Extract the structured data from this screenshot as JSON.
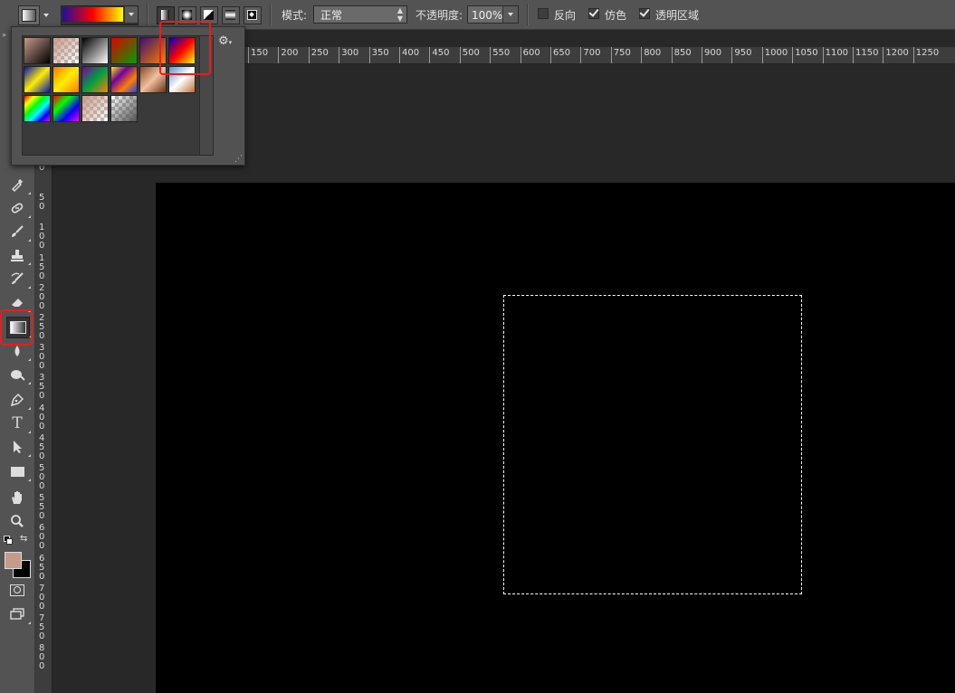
{
  "options_bar": {
    "mode_label": "模式:",
    "mode_value": "正常",
    "opacity_label": "不透明度:",
    "opacity_value": "100%",
    "reverse_label": "反向",
    "reverse_checked": false,
    "dither_label": "仿色",
    "dither_checked": true,
    "transparency_label": "透明区域",
    "transparency_checked": true,
    "gradient_colors": [
      "#1d0f9e",
      "#ff0000",
      "#ffff00"
    ],
    "gradient_types": [
      "linear",
      "radial",
      "angle",
      "reflected",
      "diamond"
    ],
    "selected_gradient_type": "linear"
  },
  "gradient_picker": {
    "gear_icon": "gear-icon",
    "swatches": [
      {
        "name": "foreground-to-background",
        "colors": [
          "#c49a8a",
          "#000000"
        ]
      },
      {
        "name": "foreground-to-transparent",
        "colors": [
          "#c49a8a",
          "transparent"
        ]
      },
      {
        "name": "black-white",
        "colors": [
          "#000000",
          "#ffffff"
        ]
      },
      {
        "name": "red-green",
        "colors": [
          "#e00000",
          "#00a000"
        ]
      },
      {
        "name": "violet-orange",
        "colors": [
          "#3a1070",
          "#ff8000"
        ]
      },
      {
        "name": "blue-red-yellow",
        "colors": [
          "#0000c0",
          "#ff0000",
          "#ffff00"
        ]
      },
      {
        "name": "blue-yellow-blue",
        "colors": [
          "#0010c0",
          "#ffee00",
          "#0010c0"
        ]
      },
      {
        "name": "orange-yellow-orange",
        "colors": [
          "#ff7a00",
          "#ffee00",
          "#ff7a00"
        ]
      },
      {
        "name": "violet-green-orange",
        "colors": [
          "#7a00a0",
          "#00a040",
          "#ff8000"
        ]
      },
      {
        "name": "yellow-violet-orange-blue",
        "colors": [
          "#ffee00",
          "#7000a0",
          "#ff8000",
          "#2040ff"
        ]
      },
      {
        "name": "copper",
        "colors": [
          "#8a4a20",
          "#f0c0a0",
          "#6a3010"
        ]
      },
      {
        "name": "chrome",
        "colors": [
          "#5a90d0",
          "#ffffff",
          "#c07030"
        ]
      },
      {
        "name": "spectrum",
        "colors": [
          "#ff0000",
          "#ffff00",
          "#00ff00",
          "#00ffff",
          "#0000ff",
          "#ff00ff"
        ]
      },
      {
        "name": "transparent-rainbow",
        "colors": [
          "#ff0000",
          "#00ff00",
          "#0000ff",
          "#ff00ff"
        ]
      },
      {
        "name": "transparent-stripes",
        "colors": [
          "#c49a8a",
          "transparent"
        ]
      },
      {
        "name": "neutral-density",
        "colors": [
          "transparent",
          "#555555"
        ]
      }
    ]
  },
  "rulers": {
    "horizontal": [
      "150",
      "200",
      "250",
      "300",
      "350",
      "400",
      "450",
      "500",
      "550",
      "600",
      "650",
      "700",
      "750",
      "800",
      "850",
      "900",
      "950",
      "1000",
      "1050",
      "1100",
      "1150",
      "1200",
      "1250"
    ],
    "vertical": [
      "0",
      "5\n0",
      "1\n0\n0",
      "1\n5\n0",
      "2\n0\n0",
      "2\n5\n0",
      "3\n0\n0",
      "3\n5\n0",
      "4\n0\n0",
      "4\n5\n0",
      "5\n0\n0",
      "5\n5\n0",
      "6\n0\n0",
      "6\n5\n0",
      "7\n0\n0",
      "7\n5\n0",
      "8\n0\n0"
    ]
  },
  "tools": [
    "eyedropper-icon",
    "healing-brush-icon",
    "brush-icon",
    "clone-stamp-icon",
    "history-brush-icon",
    "eraser-icon",
    "gradient-icon",
    "blur-icon",
    "dodge-icon",
    "pen-icon",
    "type-icon",
    "path-select-icon",
    "rectangle-icon",
    "hand-icon",
    "zoom-icon"
  ],
  "type_tool_glyph": "T",
  "colors": {
    "foreground": "#c49a8a",
    "background": "#000000",
    "highlight": "#ea1c1c"
  }
}
